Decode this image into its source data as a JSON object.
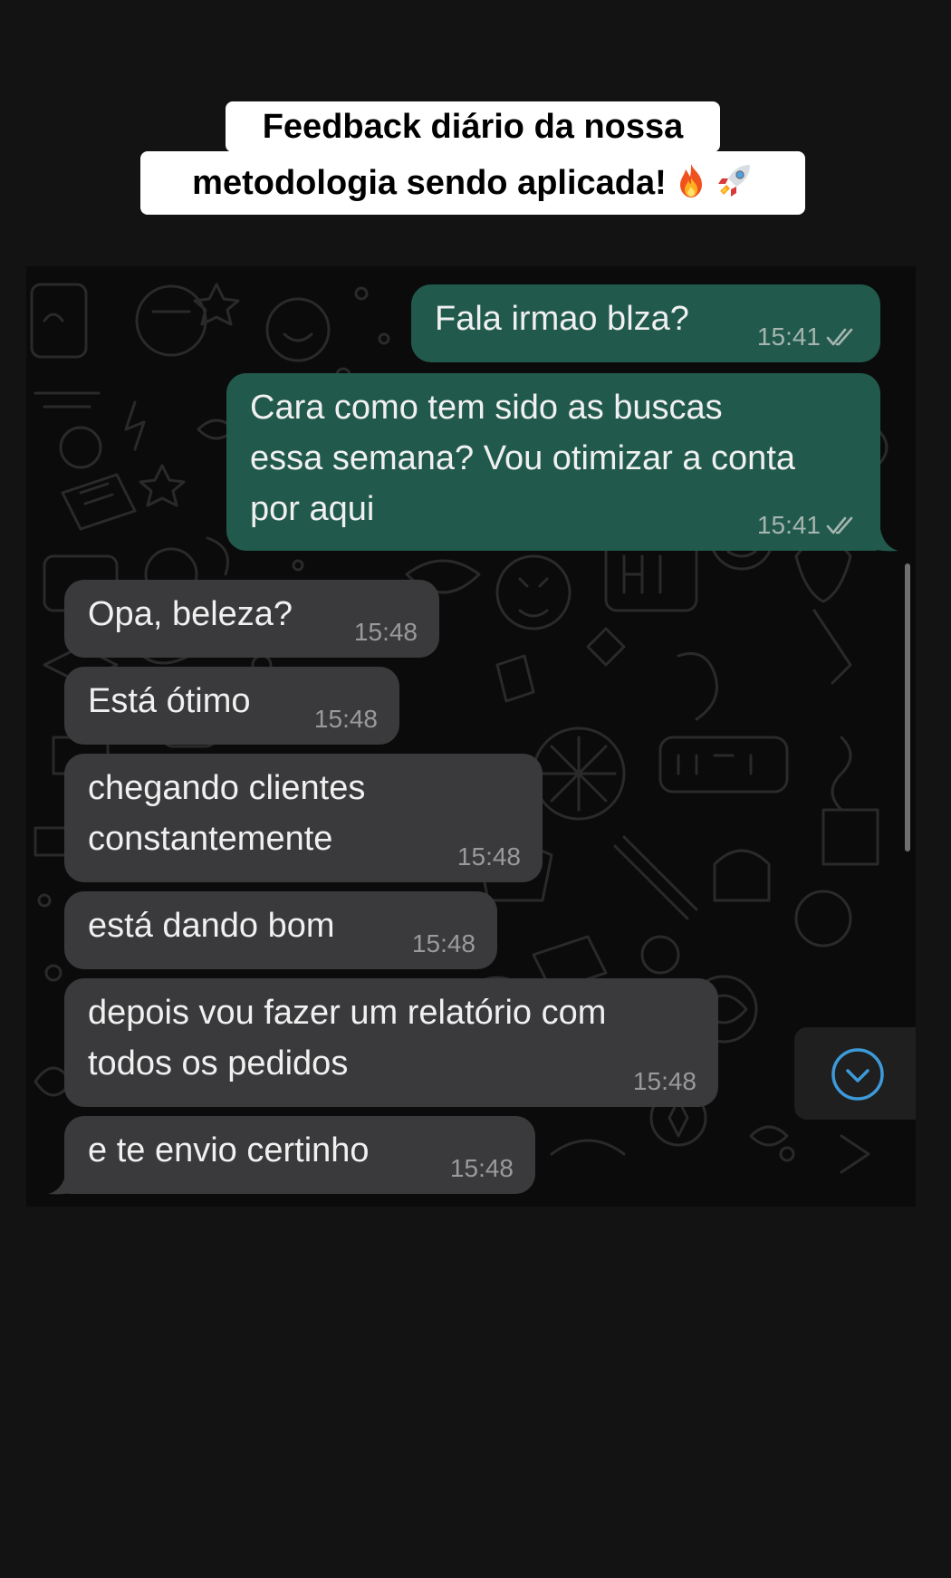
{
  "caption": {
    "line1": "Feedback diário da nossa",
    "line2": "metodologia sendo aplicada!",
    "emojis": [
      "fire-emoji",
      "rocket-emoji"
    ]
  },
  "messages": [
    {
      "direction": "outgoing",
      "text": "Fala irmao blza?",
      "time": "15:41",
      "status": "read"
    },
    {
      "direction": "outgoing",
      "lines": [
        "Cara como tem sido as buscas",
        "essa semana? Vou otimizar a conta",
        "por aqui"
      ],
      "time": "15:41",
      "status": "read"
    },
    {
      "direction": "incoming",
      "text": "Opa, beleza?",
      "time": "15:48"
    },
    {
      "direction": "incoming",
      "text": "Está ótimo",
      "time": "15:48"
    },
    {
      "direction": "incoming",
      "lines": [
        "chegando clientes",
        "constantemente"
      ],
      "time": "15:48"
    },
    {
      "direction": "incoming",
      "text": "está dando bom",
      "time": "15:48"
    },
    {
      "direction": "incoming",
      "lines": [
        "depois vou fazer um relatório com",
        "todos os pedidos"
      ],
      "time": "15:48"
    },
    {
      "direction": "incoming",
      "text": "e te envio certinho",
      "time": "15:48"
    }
  ],
  "colors": {
    "background": "#131313",
    "outgoing_bubble": "#215a4c",
    "incoming_bubble": "#3a3a3c",
    "accent": "#3d9ad9"
  },
  "icons": {
    "read_receipt": "double-check-icon",
    "scroll_down": "chevron-down-circle-icon"
  }
}
